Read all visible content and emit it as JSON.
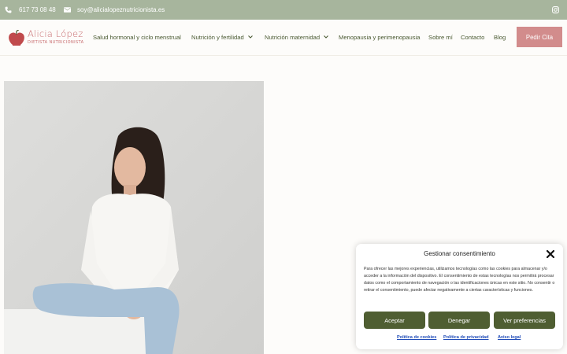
{
  "topbar": {
    "phone": "617 73 08 48",
    "email": "soy@alicialopeznutricionista.es",
    "phone_icon": "phone-icon",
    "email_icon": "envelope-icon",
    "instagram_icon": "instagram-icon"
  },
  "logo": {
    "name": "Alicia López",
    "tagline": "DIETISTA NUTRICIONISTA"
  },
  "nav": {
    "items": [
      {
        "label": "Salud hormonal y ciclo menstrual"
      },
      {
        "label": "Nutrición y fertilidad"
      },
      {
        "label": "Nutrición maternidad"
      },
      {
        "label": "Menopausia y perimenopausia"
      },
      {
        "label": "Sobre mí"
      },
      {
        "label": "Contacto"
      },
      {
        "label": "Blog"
      }
    ],
    "cta": "Pedir Cita"
  },
  "consent": {
    "title": "Gestionar consentimiento",
    "body": "Para ofrecer las mejores experiencias, utilizamos tecnologías como las cookies para almacenar y/o acceder a la información del dispositivo. El consentimiento de estas tecnologías nos permitirá procesar datos como el comportamiento de navegación o las identificaciones únicas en este sitio. No consentir o retirar el consentimiento, puede afectar negativamente a ciertas características y funciones.",
    "accept": "Aceptar",
    "deny": "Denegar",
    "preferences": "Ver preferencias",
    "links": {
      "cookies": "Política de cookies",
      "privacy": "Política de privacidad",
      "legal": "Aviso legal"
    }
  },
  "colors": {
    "topbar": "#a7b59d",
    "accent_green": "#4f5e32",
    "cta_pink": "#d28c8c",
    "logo_pink": "#c76a6d"
  }
}
